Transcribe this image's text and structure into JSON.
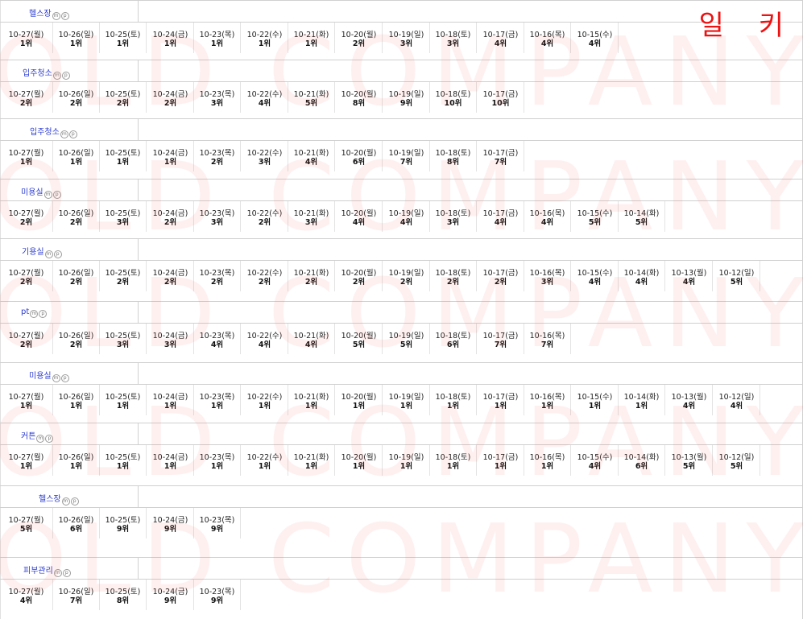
{
  "corner_label": "일 키",
  "watermark_text": "OLD COMPANY",
  "keyword_groups": [
    {
      "keyword": "헬스장",
      "dates": [
        "10-27(월)",
        "10-26(일)",
        "10-25(토)",
        "10-24(금)",
        "10-23(목)",
        "10-22(수)",
        "10-21(화)",
        "10-20(월)",
        "10-19(일)",
        "10-18(토)",
        "10-17(금)",
        "10-16(목)",
        "10-15(수)"
      ],
      "ranks": [
        "1위",
        "1위",
        "1위",
        "1위",
        "1위",
        "1위",
        "1위",
        "2위",
        "3위",
        "3위",
        "4위",
        "4위",
        "4위"
      ]
    },
    {
      "keyword": "입주청소",
      "dates": [
        "10-27(월)",
        "10-26(일)",
        "10-25(토)",
        "10-24(금)",
        "10-23(목)",
        "10-22(수)",
        "10-21(화)",
        "10-20(월)",
        "10-19(일)",
        "10-18(토)",
        "10-17(금)"
      ],
      "ranks": [
        "2위",
        "2위",
        "2위",
        "2위",
        "3위",
        "4위",
        "5위",
        "8위",
        "9위",
        "10위",
        "10위"
      ]
    },
    {
      "keyword": "입주청소",
      "dates": [
        "10-27(월)",
        "10-26(일)",
        "10-25(토)",
        "10-24(금)",
        "10-23(목)",
        "10-22(수)",
        "10-21(화)",
        "10-20(월)",
        "10-19(일)",
        "10-18(토)",
        "10-17(금)"
      ],
      "ranks": [
        "1위",
        "1위",
        "1위",
        "1위",
        "2위",
        "3위",
        "4위",
        "6위",
        "7위",
        "8위",
        "7위"
      ]
    },
    {
      "keyword": "미용실",
      "dates": [
        "10-27(월)",
        "10-26(일)",
        "10-25(토)",
        "10-24(금)",
        "10-23(목)",
        "10-22(수)",
        "10-21(화)",
        "10-20(월)",
        "10-19(일)",
        "10-18(토)",
        "10-17(금)",
        "10-16(목)",
        "10-15(수)",
        "10-14(화)"
      ],
      "ranks": [
        "2위",
        "2위",
        "3위",
        "2위",
        "3위",
        "2위",
        "3위",
        "4위",
        "4위",
        "3위",
        "4위",
        "4위",
        "5위",
        "5위"
      ]
    },
    {
      "keyword": "기용실",
      "dates": [
        "10-27(월)",
        "10-26(일)",
        "10-25(토)",
        "10-24(금)",
        "10-23(목)",
        "10-22(수)",
        "10-21(화)",
        "10-20(월)",
        "10-19(일)",
        "10-18(토)",
        "10-17(금)",
        "10-16(목)",
        "10-15(수)",
        "10-14(화)",
        "10-13(월)",
        "10-12(일)"
      ],
      "ranks": [
        "2위",
        "2위",
        "2위",
        "2위",
        "2위",
        "2위",
        "2위",
        "2위",
        "2위",
        "2위",
        "2위",
        "3위",
        "4위",
        "4위",
        "4위",
        "5위"
      ]
    },
    {
      "keyword": "pt",
      "dates": [
        "10-27(월)",
        "10-26(일)",
        "10-25(토)",
        "10-24(금)",
        "10-23(목)",
        "10-22(수)",
        "10-21(화)",
        "10-20(월)",
        "10-19(일)",
        "10-18(토)",
        "10-17(금)",
        "10-16(목)"
      ],
      "ranks": [
        "2위",
        "2위",
        "3위",
        "3위",
        "4위",
        "4위",
        "4위",
        "5위",
        "5위",
        "6위",
        "7위",
        "7위"
      ]
    },
    {
      "keyword": "미용실",
      "dates": [
        "10-27(월)",
        "10-26(일)",
        "10-25(토)",
        "10-24(금)",
        "10-23(목)",
        "10-22(수)",
        "10-21(화)",
        "10-20(월)",
        "10-19(일)",
        "10-18(토)",
        "10-17(금)",
        "10-16(목)",
        "10-15(수)",
        "10-14(화)",
        "10-13(월)",
        "10-12(일)"
      ],
      "ranks": [
        "1위",
        "1위",
        "1위",
        "1위",
        "1위",
        "1위",
        "1위",
        "1위",
        "1위",
        "1위",
        "1위",
        "1위",
        "1위",
        "1위",
        "4위",
        "4위"
      ]
    },
    {
      "keyword": "커튼",
      "dates": [
        "10-27(월)",
        "10-26(일)",
        "10-25(토)",
        "10-24(금)",
        "10-23(목)",
        "10-22(수)",
        "10-21(화)",
        "10-20(월)",
        "10-19(일)",
        "10-18(토)",
        "10-17(금)",
        "10-16(목)",
        "10-15(수)",
        "10-14(화)",
        "10-13(월)",
        "10-12(일)"
      ],
      "ranks": [
        "1위",
        "1위",
        "1위",
        "1위",
        "1위",
        "1위",
        "1위",
        "1위",
        "1위",
        "1위",
        "1위",
        "1위",
        "4위",
        "6위",
        "5위",
        "5위"
      ]
    },
    {
      "keyword": "헬스장",
      "dates": [
        "10-27(월)",
        "10-26(일)",
        "10-25(토)",
        "10-24(금)",
        "10-23(목)"
      ],
      "ranks": [
        "5위",
        "6위",
        "9위",
        "9위",
        "9위"
      ]
    },
    {
      "keyword": "피부관리",
      "dates": [
        "10-27(월)",
        "10-26(일)",
        "10-25(토)",
        "10-24(금)",
        "10-23(목)"
      ],
      "ranks": [
        "4위",
        "7위",
        "8위",
        "9위",
        "9위"
      ]
    }
  ]
}
